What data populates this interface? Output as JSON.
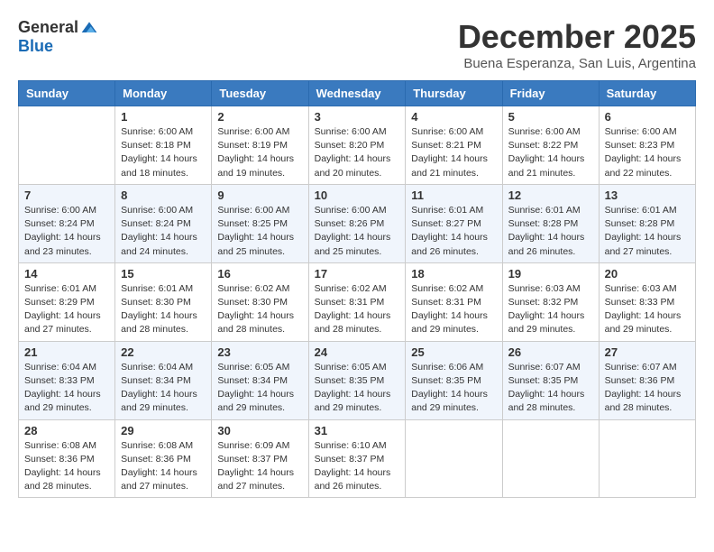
{
  "header": {
    "logo_general": "General",
    "logo_blue": "Blue",
    "month_title": "December 2025",
    "location": "Buena Esperanza, San Luis, Argentina"
  },
  "days_of_week": [
    "Sunday",
    "Monday",
    "Tuesday",
    "Wednesday",
    "Thursday",
    "Friday",
    "Saturday"
  ],
  "weeks": [
    [
      {
        "day": "",
        "info": ""
      },
      {
        "day": "1",
        "info": "Sunrise: 6:00 AM\nSunset: 8:18 PM\nDaylight: 14 hours\nand 18 minutes."
      },
      {
        "day": "2",
        "info": "Sunrise: 6:00 AM\nSunset: 8:19 PM\nDaylight: 14 hours\nand 19 minutes."
      },
      {
        "day": "3",
        "info": "Sunrise: 6:00 AM\nSunset: 8:20 PM\nDaylight: 14 hours\nand 20 minutes."
      },
      {
        "day": "4",
        "info": "Sunrise: 6:00 AM\nSunset: 8:21 PM\nDaylight: 14 hours\nand 21 minutes."
      },
      {
        "day": "5",
        "info": "Sunrise: 6:00 AM\nSunset: 8:22 PM\nDaylight: 14 hours\nand 21 minutes."
      },
      {
        "day": "6",
        "info": "Sunrise: 6:00 AM\nSunset: 8:23 PM\nDaylight: 14 hours\nand 22 minutes."
      }
    ],
    [
      {
        "day": "7",
        "info": "Sunrise: 6:00 AM\nSunset: 8:24 PM\nDaylight: 14 hours\nand 23 minutes."
      },
      {
        "day": "8",
        "info": "Sunrise: 6:00 AM\nSunset: 8:24 PM\nDaylight: 14 hours\nand 24 minutes."
      },
      {
        "day": "9",
        "info": "Sunrise: 6:00 AM\nSunset: 8:25 PM\nDaylight: 14 hours\nand 25 minutes."
      },
      {
        "day": "10",
        "info": "Sunrise: 6:00 AM\nSunset: 8:26 PM\nDaylight: 14 hours\nand 25 minutes."
      },
      {
        "day": "11",
        "info": "Sunrise: 6:01 AM\nSunset: 8:27 PM\nDaylight: 14 hours\nand 26 minutes."
      },
      {
        "day": "12",
        "info": "Sunrise: 6:01 AM\nSunset: 8:28 PM\nDaylight: 14 hours\nand 26 minutes."
      },
      {
        "day": "13",
        "info": "Sunrise: 6:01 AM\nSunset: 8:28 PM\nDaylight: 14 hours\nand 27 minutes."
      }
    ],
    [
      {
        "day": "14",
        "info": "Sunrise: 6:01 AM\nSunset: 8:29 PM\nDaylight: 14 hours\nand 27 minutes."
      },
      {
        "day": "15",
        "info": "Sunrise: 6:01 AM\nSunset: 8:30 PM\nDaylight: 14 hours\nand 28 minutes."
      },
      {
        "day": "16",
        "info": "Sunrise: 6:02 AM\nSunset: 8:30 PM\nDaylight: 14 hours\nand 28 minutes."
      },
      {
        "day": "17",
        "info": "Sunrise: 6:02 AM\nSunset: 8:31 PM\nDaylight: 14 hours\nand 28 minutes."
      },
      {
        "day": "18",
        "info": "Sunrise: 6:02 AM\nSunset: 8:31 PM\nDaylight: 14 hours\nand 29 minutes."
      },
      {
        "day": "19",
        "info": "Sunrise: 6:03 AM\nSunset: 8:32 PM\nDaylight: 14 hours\nand 29 minutes."
      },
      {
        "day": "20",
        "info": "Sunrise: 6:03 AM\nSunset: 8:33 PM\nDaylight: 14 hours\nand 29 minutes."
      }
    ],
    [
      {
        "day": "21",
        "info": "Sunrise: 6:04 AM\nSunset: 8:33 PM\nDaylight: 14 hours\nand 29 minutes."
      },
      {
        "day": "22",
        "info": "Sunrise: 6:04 AM\nSunset: 8:34 PM\nDaylight: 14 hours\nand 29 minutes."
      },
      {
        "day": "23",
        "info": "Sunrise: 6:05 AM\nSunset: 8:34 PM\nDaylight: 14 hours\nand 29 minutes."
      },
      {
        "day": "24",
        "info": "Sunrise: 6:05 AM\nSunset: 8:35 PM\nDaylight: 14 hours\nand 29 minutes."
      },
      {
        "day": "25",
        "info": "Sunrise: 6:06 AM\nSunset: 8:35 PM\nDaylight: 14 hours\nand 29 minutes."
      },
      {
        "day": "26",
        "info": "Sunrise: 6:07 AM\nSunset: 8:35 PM\nDaylight: 14 hours\nand 28 minutes."
      },
      {
        "day": "27",
        "info": "Sunrise: 6:07 AM\nSunset: 8:36 PM\nDaylight: 14 hours\nand 28 minutes."
      }
    ],
    [
      {
        "day": "28",
        "info": "Sunrise: 6:08 AM\nSunset: 8:36 PM\nDaylight: 14 hours\nand 28 minutes."
      },
      {
        "day": "29",
        "info": "Sunrise: 6:08 AM\nSunset: 8:36 PM\nDaylight: 14 hours\nand 27 minutes."
      },
      {
        "day": "30",
        "info": "Sunrise: 6:09 AM\nSunset: 8:37 PM\nDaylight: 14 hours\nand 27 minutes."
      },
      {
        "day": "31",
        "info": "Sunrise: 6:10 AM\nSunset: 8:37 PM\nDaylight: 14 hours\nand 26 minutes."
      },
      {
        "day": "",
        "info": ""
      },
      {
        "day": "",
        "info": ""
      },
      {
        "day": "",
        "info": ""
      }
    ]
  ]
}
